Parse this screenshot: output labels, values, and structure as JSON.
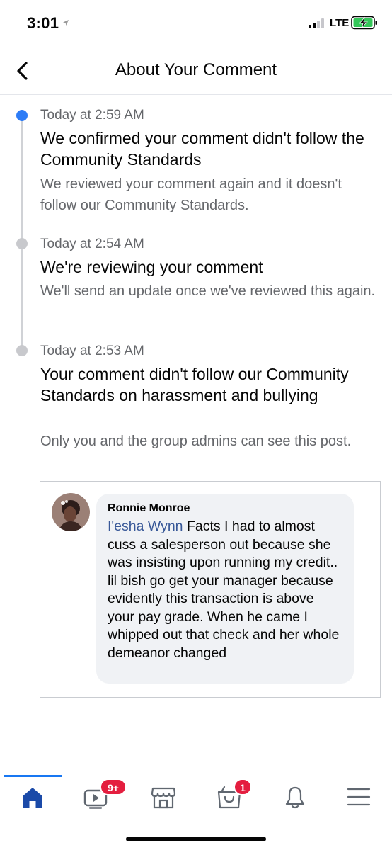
{
  "status_bar": {
    "time": "3:01",
    "network": "LTE"
  },
  "header": {
    "title": "About Your Comment"
  },
  "timeline": [
    {
      "time": "Today at 2:59 AM",
      "title": "We confirmed your comment didn't follow the Community Standards",
      "description": "We reviewed your comment again and it doesn't follow our Community Standards.",
      "state": "active"
    },
    {
      "time": "Today at 2:54 AM",
      "title": "We're reviewing your comment",
      "description": "We'll send an update once we've reviewed this again.",
      "state": "past"
    },
    {
      "time": "Today at 2:53 AM",
      "title": "Your comment didn't follow our Community Standards on harassment and bullying",
      "description": "Only you and the group admins can see this post.",
      "state": "past"
    }
  ],
  "comment": {
    "author": "Ronnie Monroe",
    "mention": "I'esha Wynn",
    "text_lines": [
      " Facts I had to almost cuss a salesperson out because she was insisting upon running my credit..",
      "lil bish go get your manager because evidently this transaction is above your pay grade. When he came I whipped out that check and her whole demeanor changed"
    ]
  },
  "bottom_nav": {
    "video_badge": "9+",
    "marketplace_badge": "1",
    "active_tab": "home"
  },
  "colors": {
    "accent": "#1877f2",
    "active_dot": "#2d7cf6",
    "badge": "#e41e3f",
    "mention": "#385898",
    "secondary_text": "#65676b"
  }
}
